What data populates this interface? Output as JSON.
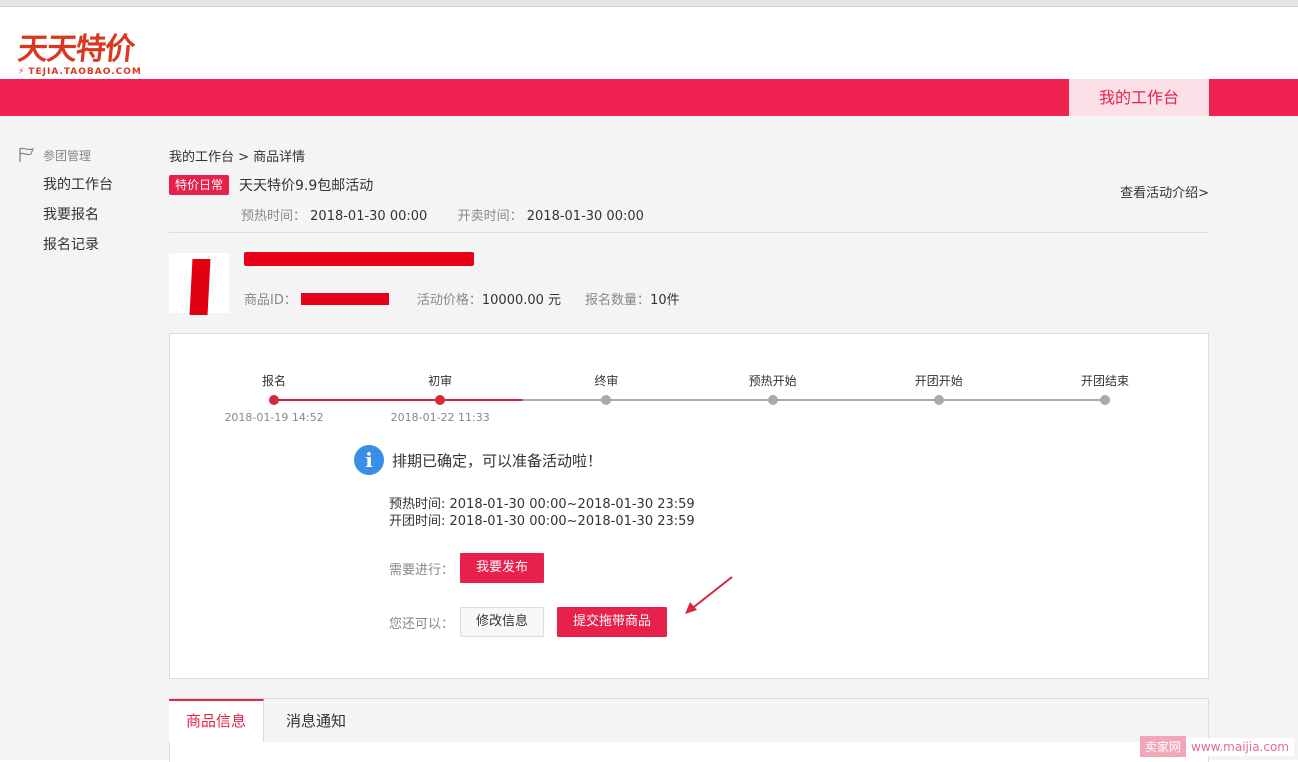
{
  "logo": {
    "main": "天天特价",
    "sub": "TEJIA.TAOBAO.COM"
  },
  "topnav": {
    "workbench": "我的工作台"
  },
  "sidebar": {
    "title": "参团管理",
    "items": [
      {
        "label": "我的工作台"
      },
      {
        "label": "我要报名"
      },
      {
        "label": "报名记录"
      }
    ]
  },
  "breadcrumb": "我的工作台 > 商品详情",
  "activity": {
    "tag": "特价日常",
    "title": "天天特价9.9包邮活动",
    "preheat_label": "预热时间：",
    "preheat_value": "2018-01-30 00:00",
    "open_label": "开卖时间：",
    "open_value": "2018-01-30 00:00",
    "intro_link": "查看活动介绍>"
  },
  "product": {
    "id_label": "商品ID：",
    "price_label": "活动价格：",
    "price_value": "10000.00 元",
    "qty_label": "报名数量：",
    "qty_value": "10件"
  },
  "timeline": {
    "steps": [
      {
        "label": "报名",
        "date": "2018-01-19 14:52",
        "done": true
      },
      {
        "label": "初审",
        "date": "2018-01-22 11:33",
        "done": true
      },
      {
        "label": "终审",
        "date": "",
        "done": false
      },
      {
        "label": "预热开始",
        "date": "",
        "done": false
      },
      {
        "label": "开团开始",
        "date": "",
        "done": false
      },
      {
        "label": "开团结束",
        "date": "",
        "done": false
      }
    ],
    "active_color": "#d7263d",
    "inactive_color": "#aaaaaa"
  },
  "notice": {
    "icon": "info-icon",
    "text": "排期已确定，可以准备活动啦！",
    "preheat_line": "预热时间: 2018-01-30 00:00~2018-01-30 23:59",
    "open_line": "开团时间: 2018-01-30 00:00~2018-01-30 23:59"
  },
  "actions": {
    "need_label": "需要进行：",
    "publish_button": "我要发布",
    "also_label": "您还可以：",
    "modify_button": "修改信息",
    "submit_button": "提交拖带商品"
  },
  "tabs": [
    {
      "label": "商品信息",
      "active": true
    },
    {
      "label": "消息通知",
      "active": false
    }
  ],
  "watermark": {
    "brand": "卖家网",
    "url": "www.maijia.com"
  },
  "colors": {
    "brand_red": "#f02150",
    "accent": "#e8204c",
    "info_blue": "#3a8ee6"
  }
}
